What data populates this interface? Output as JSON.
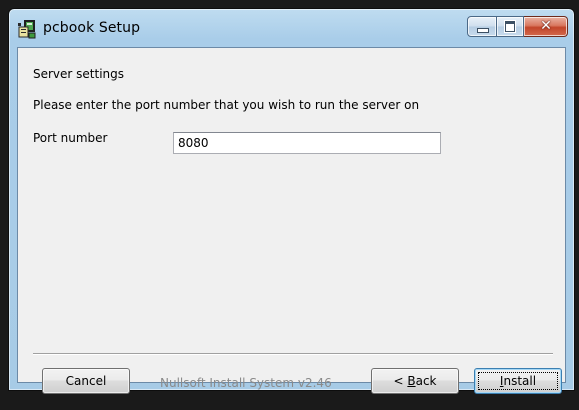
{
  "window": {
    "title": "pcbook Setup",
    "app_icon": "installer-package-icon",
    "caption_buttons": {
      "minimize_icon": "minimize-icon",
      "maximize_icon": "maximize-icon",
      "close_icon": "close-icon",
      "close_glyph": "✕"
    }
  },
  "page": {
    "heading": "Server settings",
    "instructions": "Please enter the port number that you wish to run the server on",
    "port_label": "Port number",
    "port_value": "8080"
  },
  "footer": {
    "branding": "Nullsoft Install System v2.46",
    "cancel_label": "Cancel",
    "back_prefix": "< ",
    "back_accel": "B",
    "back_rest": "ack",
    "install_accel": "I",
    "install_rest": "nstall"
  },
  "colors": {
    "titlebar": "#a9cde9",
    "client_bg": "#f0f0f0",
    "close_button": "#c2452a",
    "default_button_border": "#3c7fb1"
  }
}
